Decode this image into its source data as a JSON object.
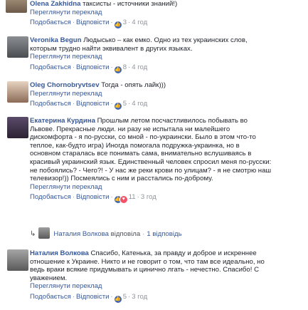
{
  "comments": [
    {
      "author": "Olena Zakhidna",
      "lines": [
        "таксисты - источники знаний!)"
      ],
      "see_translation": "Переглянути переклад",
      "like": "Подобається",
      "reply": "Відповісти",
      "reactions_count": "3",
      "time": "4 год"
    },
    {
      "author": "Veronika Begun",
      "lines": [
        "Людыськo – как емко. Одно из тех украинских слов,",
        "которым трудно найти эквивалент в других языках."
      ],
      "see_translation": "Переглянути переклад",
      "like": "Подобається",
      "reply": "Відповісти",
      "reactions_count": "8",
      "time": "4 год"
    },
    {
      "author": "Oleg Chornobryvtsev",
      "lines": [
        "Тогда - опять лайк)))"
      ],
      "see_translation": "Переглянути переклад",
      "like": "Подобається",
      "reply": "Відповісти",
      "reactions_count": "5",
      "time": "4 год"
    },
    {
      "author": "Екатерина Курдина",
      "lines": [
        "Прошлым летом посчастливилось побывать во",
        "Львове. Прекрасные люди. ни разу не испытала ни малейшего",
        "дискомфорта - я по-русски, со мной - по-украински. Было в этом что-то",
        "теплое, как-будто игра) Иногда помогала подружка-украинка, но в",
        "основном старалась все понимать сама, внимательно вслушиваясь в",
        "красивый украинский язык. Единственный человек спросил меня по-русски:",
        "не побоялись? - Чего?! - У нас же реки крови по улицам? - я не смотрю наш",
        "телевизор!)) Посмеялись с ним и расстались по-доброму."
      ],
      "see_translation": "Переглянути переклад",
      "like": "Подобається",
      "reply": "Відповісти",
      "reactions_count": "11",
      "time": "3 год"
    },
    {
      "author": "Наталия Волкова",
      "lines": [
        "Спасибо, Катенька, за правду и доброе и искреннее",
        "отношение к Украине. Никто и не говорит о том, что там все идеально, но",
        "ведь враки всякие придумывать и цинично лгать - нечестно. Спасибо! С",
        "уважением."
      ],
      "see_translation": "Переглянути переклад",
      "like": "Подобається",
      "reply": "Відповісти",
      "reactions_count": "5",
      "time": "3 год"
    }
  ],
  "replies_row": {
    "author": "Наталия Волкова",
    "action": "відповіла",
    "count": "1 відповідь"
  }
}
